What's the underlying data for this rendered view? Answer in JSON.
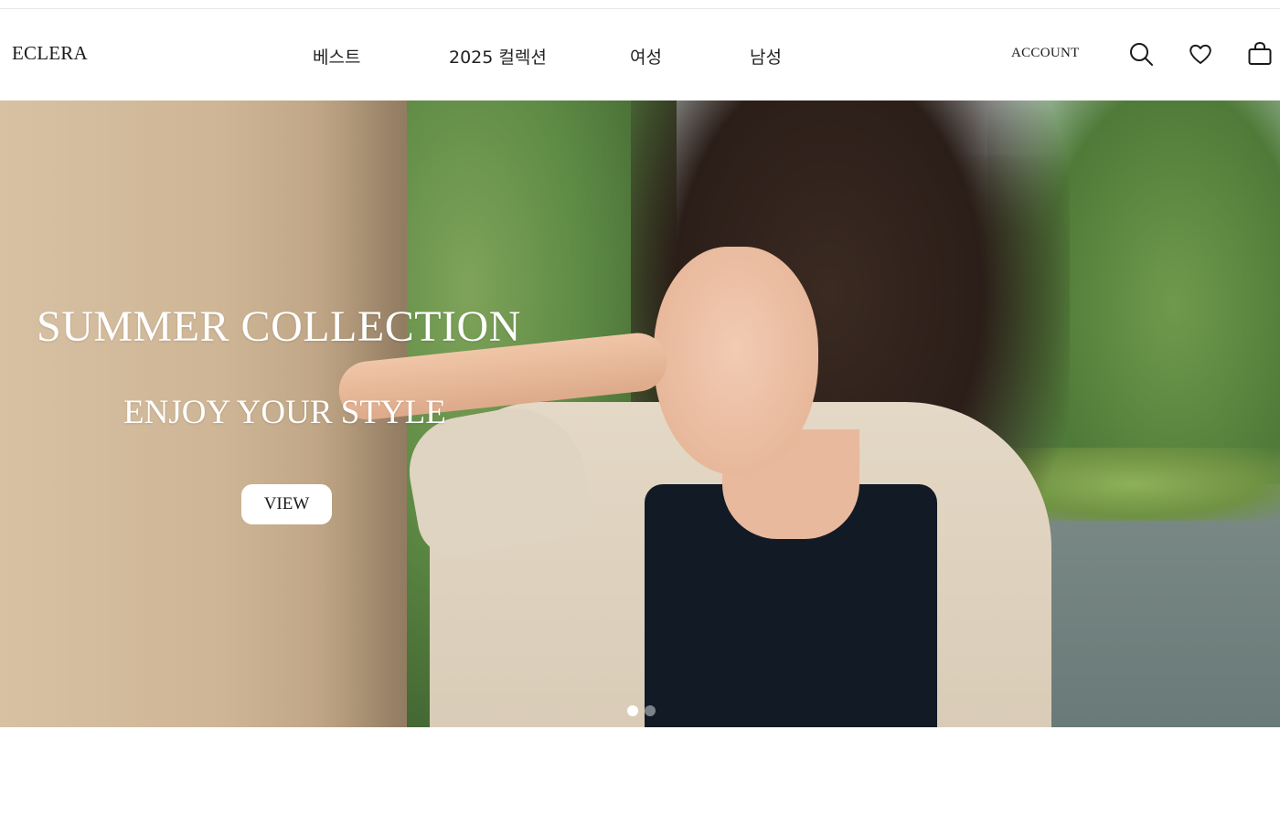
{
  "header": {
    "logo": "ECLERA",
    "nav": [
      "베스트",
      "2025 컬렉션",
      "여성",
      "남성"
    ],
    "account_label": "ACCOUNT",
    "icons": [
      "search-icon",
      "heart-icon",
      "shopping-bag-icon"
    ]
  },
  "hero": {
    "title": "SUMMER COLLECTION",
    "subtitle": "ENJOY YOUR STYLE",
    "cta_label": "VIEW",
    "slide_count": 2,
    "active_slide": 1
  },
  "colors": {
    "text": "#1a1a1a",
    "hero_text": "#ffffff",
    "button_bg": "#ffffff"
  }
}
